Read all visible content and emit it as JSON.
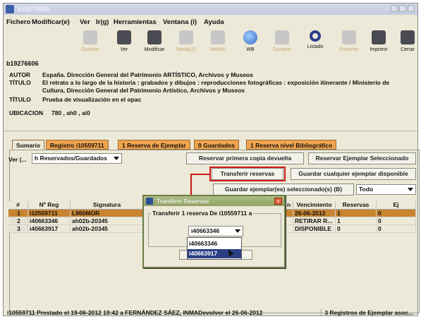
{
  "window": {
    "title": "b19276606"
  },
  "menubar": [
    "Fichero",
    "Modificar(e)",
    "Ver",
    "Ir(g)",
    "Herramientas",
    "Ventana (i)",
    "Ayuda"
  ],
  "toolbar": [
    {
      "label": "Guardar",
      "icon": "save-icon",
      "enabled": false
    },
    {
      "label": "Ver",
      "icon": "view-icon",
      "enabled": true
    },
    {
      "label": "Modificar",
      "icon": "edit-icon",
      "enabled": true
    },
    {
      "label": "Media(2)",
      "icon": "media-icon",
      "enabled": false
    },
    {
      "label": "Web(9)",
      "icon": "web-icon",
      "enabled": false
    },
    {
      "label": "WB",
      "icon": "globe-icon",
      "enabled": true
    },
    {
      "label": "Sumario",
      "icon": "summary-icon",
      "enabled": false
    },
    {
      "label": "Listado",
      "icon": "search-icon",
      "enabled": true
    },
    {
      "label": "Exportar",
      "icon": "export-icon",
      "enabled": false
    },
    {
      "label": "Imprimir",
      "icon": "print-icon",
      "enabled": true
    },
    {
      "label": "Cerrar",
      "icon": "close-icon",
      "enabled": true
    }
  ],
  "record": {
    "id": "b19276606",
    "fields": [
      {
        "key": "AUTOR",
        "value": "España. Dirección General del Patrimonio ARTÍSTICO, Archivos y Museos"
      },
      {
        "key": "TÍTULO",
        "value": "El retrato a lo largo de la historia : grabados y dibujos : reproducciones fotográficas : exposición itinerante / Ministerio de Cultura, Dirección General del Patrimonio Artístico, Archivos y Museos"
      },
      {
        "key": "TÍTULO",
        "value": "Prueba de visualización en el opac"
      },
      {
        "key": "UBICACION",
        "value": "780 , ah0 , ai0"
      }
    ]
  },
  "tabs": [
    "Sumario",
    "Registro i10559711",
    "1 Reserva de Ejemplar",
    "0 Guardados",
    "1 Reserva nivel Bibliográfico"
  ],
  "controls": {
    "ver_label": "Ver (...",
    "ver_select": "h Reservados/Guardados",
    "btn_reservar_primera": "Reservar primera copia devuelta",
    "btn_reservar_ejemplar": "Reservar Ejemplar Seleccionado",
    "btn_transferir": "Transferir reservas",
    "btn_guardar_cualquier": "Guardar cualquier ejemplar disponible",
    "btn_guardar_seleccionados": "Guardar ejemplar(es) seleccionado(s) (B)",
    "filter_select": "Todo"
  },
  "table": {
    "columns": [
      "#",
      "Nº Reg",
      "Signatura",
      "Vencimiento",
      "Reservas",
      "Ej Guardados"
    ],
    "hidden_col_tail": "n",
    "rows": [
      {
        "n": "1",
        "reg": "i10559711",
        "sig": "L860MOR",
        "venc": "26-06-2012",
        "res": "1",
        "guard": "0",
        "selected": true
      },
      {
        "n": "2",
        "reg": "i40663346",
        "sig": "ah02b-20345",
        "venc": "RETIRAR R...",
        "res": "1",
        "guard": "0",
        "selected": false
      },
      {
        "n": "3",
        "reg": "i40663917",
        "sig": "ah02b-20345",
        "venc": "DISPONIBLE",
        "res": "0",
        "guard": "0",
        "selected": false
      }
    ]
  },
  "dialog": {
    "title": "Transferir Reservas",
    "legend": "Transferir 1 reserva De i10559711 a",
    "selected": "i40663346",
    "options": [
      "i40663346",
      "i40663917"
    ],
    "highlighted": "i40663917"
  },
  "status": {
    "left": "i10559711 Prestado el 19-06-2012 19:42 a FERNÁNDEZ SÁEZ, INMADevolver el 26-06-2012",
    "right": "3 Registros de Ejemplar asoc..."
  },
  "colors": {
    "tab_orange": "#f1a44e",
    "selected_row": "#c9842f",
    "highlight_red": "#d01919",
    "dialog_title": "#92a365"
  }
}
